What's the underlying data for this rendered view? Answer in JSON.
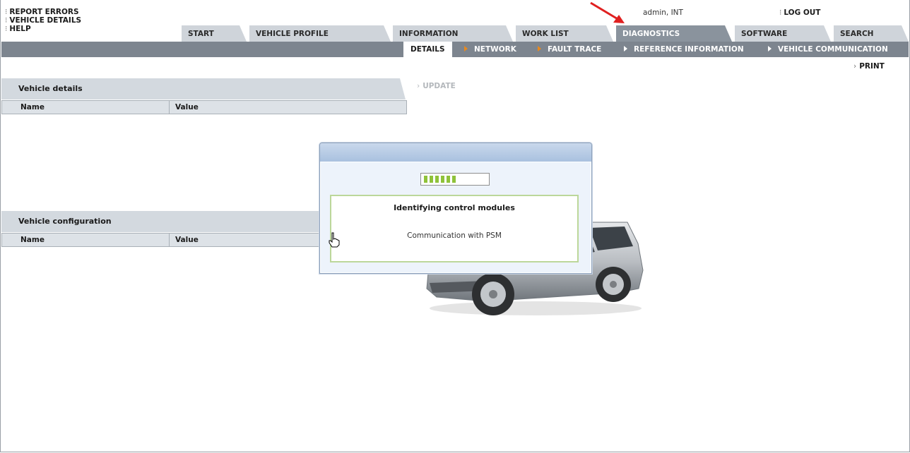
{
  "top_links": [
    "REPORT ERRORS",
    "VEHICLE DETAILS",
    "HELP"
  ],
  "user": "admin, INT",
  "logout_label": "LOG OUT",
  "tabs": [
    "START",
    "VEHICLE PROFILE",
    "INFORMATION",
    "WORK LIST",
    "DIAGNOSTICS",
    "SOFTWARE",
    "SEARCH"
  ],
  "active_tab": "DIAGNOSTICS",
  "subnav": [
    "DETAILS",
    "NETWORK",
    "FAULT TRACE",
    "REFERENCE INFORMATION",
    "VEHICLE COMMUNICATION"
  ],
  "active_subnav": "DETAILS",
  "print_label": "PRINT",
  "update_label": "UPDATE",
  "vehicle_details": {
    "title": "Vehicle details",
    "col_name": "Name",
    "col_value": "Value"
  },
  "vehicle_config": {
    "title": "Vehicle configuration",
    "col_name": "Name",
    "col_value": "Value"
  },
  "dialog": {
    "title": "Identifying control modules",
    "status": "Communication with PSM",
    "progress_segments_filled": 6
  },
  "colors": {
    "active_tab": "#8a939d",
    "subnav_bg": "#7d858f",
    "accent_orange": "#e8891e",
    "progress_green": "#8fc23a",
    "annotation_arrow": "#e02020"
  },
  "icons": [
    "hand-cursor-icon",
    "annotation-arrow-icon",
    "vehicle-image"
  ]
}
